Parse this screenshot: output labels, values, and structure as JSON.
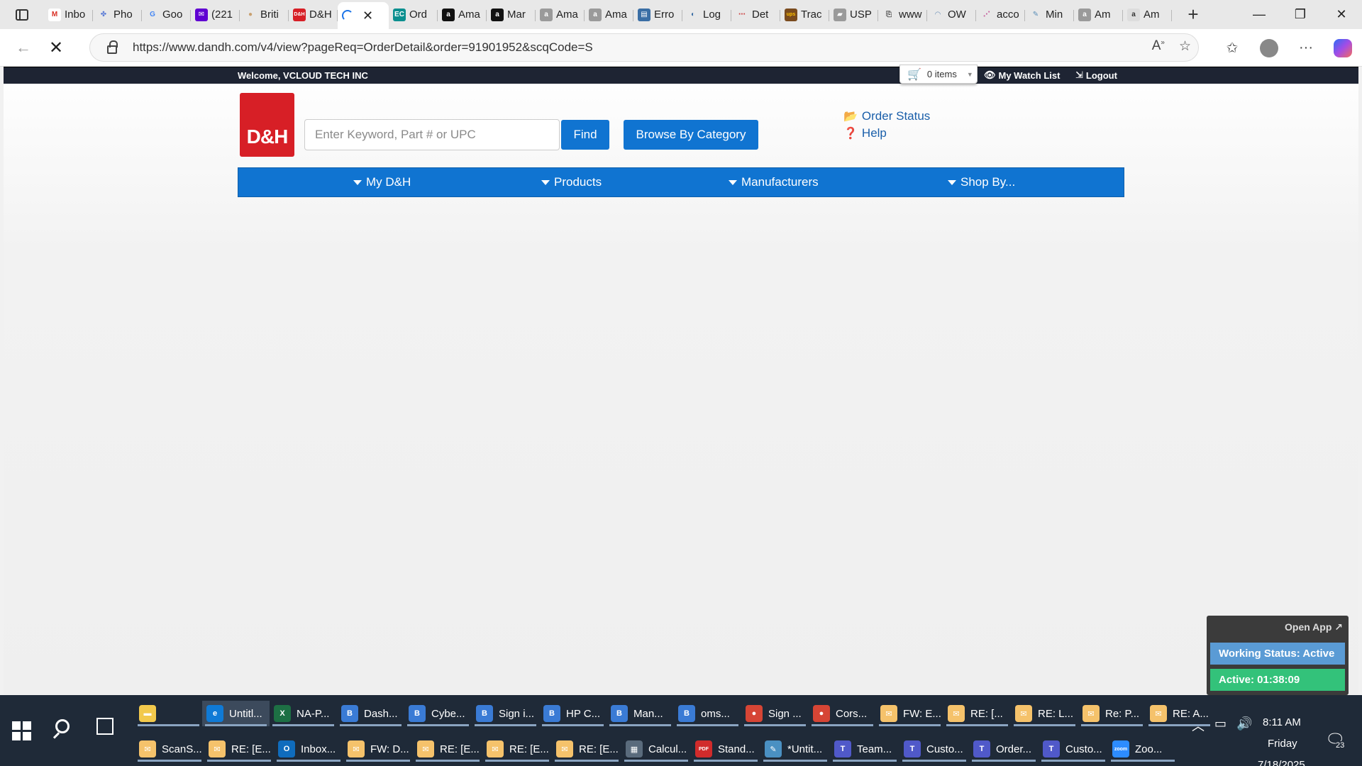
{
  "browser": {
    "tabs": [
      {
        "title": "Inbo",
        "fav_color": "#ffffff",
        "fav_text": "M",
        "fav_fg": "#d93025"
      },
      {
        "title": "Pho",
        "fav_color": "#e8e8e8",
        "fav_text": "✤",
        "fav_fg": "#5a7bd6"
      },
      {
        "title": "Goo",
        "fav_color": "#e8e8e8",
        "fav_text": "G",
        "fav_fg": "#4285f4"
      },
      {
        "title": "(221",
        "fav_color": "#6001d2",
        "fav_text": "✉",
        "fav_fg": "#ffffff"
      },
      {
        "title": "Briti",
        "fav_color": "#e8e8e8",
        "fav_text": "●",
        "fav_fg": "#c8a070"
      },
      {
        "title": "D&H",
        "fav_color": "#d71f26",
        "fav_text": "D&H",
        "fav_fg": "#ffffff"
      },
      {
        "title": "",
        "loading": true
      },
      {
        "title": "Ord",
        "fav_color": "#0b8f8f",
        "fav_text": "EC",
        "fav_fg": "#ffffff"
      },
      {
        "title": "Ama",
        "fav_color": "#111111",
        "fav_text": "a",
        "fav_fg": "#ffffff"
      },
      {
        "title": "Mar",
        "fav_color": "#111111",
        "fav_text": "a",
        "fav_fg": "#ffffff"
      },
      {
        "title": "Ama",
        "fav_color": "#9a9a9a",
        "fav_text": "a",
        "fav_fg": "#ffffff"
      },
      {
        "title": "Ama",
        "fav_color": "#9a9a9a",
        "fav_text": "a",
        "fav_fg": "#ffffff"
      },
      {
        "title": "Erro",
        "fav_color": "#3a6ea5",
        "fav_text": "▤",
        "fav_fg": "#ffffff"
      },
      {
        "title": "Log",
        "fav_color": "#e8e8e8",
        "fav_text": "◐",
        "fav_fg": "#3a6ea5"
      },
      {
        "title": "Det",
        "fav_color": "#e8e8e8",
        "fav_text": "⋯",
        "fav_fg": "#c44"
      },
      {
        "title": "Trac",
        "fav_color": "#7a4b1e",
        "fav_text": "ups",
        "fav_fg": "#ffc300"
      },
      {
        "title": "USP",
        "fav_color": "#9a9a9a",
        "fav_text": "▰",
        "fav_fg": "#ffffff"
      },
      {
        "title": "www",
        "fav_color": "#e8e8e8",
        "fav_text": "⎘",
        "fav_fg": "#555"
      },
      {
        "title": "OW",
        "fav_color": "#e8e8e8",
        "fav_text": "◠",
        "fav_fg": "#6b8fb8"
      },
      {
        "title": "acco",
        "fav_color": "#e8e8e8",
        "fav_text": "⋰",
        "fav_fg": "#c45a9a"
      },
      {
        "title": "Min",
        "fav_color": "#e8e8e8",
        "fav_text": "✎",
        "fav_fg": "#5a8fb8"
      },
      {
        "title": "Am",
        "fav_color": "#9a9a9a",
        "fav_text": "a",
        "fav_fg": "#ffffff"
      },
      {
        "title": "Am",
        "fav_color": "#dddddd",
        "fav_text": "a",
        "fav_fg": "#333"
      }
    ],
    "url": "https://www.dandh.com/v4/view?pageReq=OrderDetail&order=91901952&scqCode=S",
    "new_tab_glyph": "+",
    "close_glyph": "✕"
  },
  "header": {
    "welcome": "Welcome, VCLOUD TECH INC",
    "cart_label": "0 items",
    "watch_list": "My Watch List",
    "logout": "Logout",
    "logo_text": "D&H",
    "search_placeholder": "Enter Keyword, Part # or UPC",
    "find_label": "Find",
    "browse_label": "Browse By Category",
    "order_status": "Order Status",
    "help": "Help"
  },
  "nav": {
    "items": [
      "My D&H",
      "Products",
      "Manufacturers",
      "Shop By..."
    ]
  },
  "tracker": {
    "open_app": "Open App ↗",
    "working_status": "Working Status: Active",
    "active_time": "Active: 01:38:09"
  },
  "taskbar": {
    "row1": [
      {
        "label": "",
        "icon_color": "#f2c94c",
        "icon_text": "▬"
      },
      {
        "label": "Untitl...",
        "icon_color": "#0f7ad6",
        "icon_text": "e",
        "active": true
      },
      {
        "label": "NA-P...",
        "icon_color": "#1d7044",
        "icon_text": "X"
      },
      {
        "label": "Dash...",
        "icon_color": "#3a7bd5",
        "icon_text": "B"
      },
      {
        "label": "Cybe...",
        "icon_color": "#3a7bd5",
        "icon_text": "B"
      },
      {
        "label": "Sign i...",
        "icon_color": "#3a7bd5",
        "icon_text": "B"
      },
      {
        "label": "HP C...",
        "icon_color": "#3a7bd5",
        "icon_text": "B"
      },
      {
        "label": "Man...",
        "icon_color": "#3a7bd5",
        "icon_text": "B"
      },
      {
        "label": "oms...",
        "icon_color": "#3a7bd5",
        "icon_text": "B"
      },
      {
        "label": "Sign ...",
        "icon_color": "#d64535",
        "icon_text": "●"
      },
      {
        "label": "Cors...",
        "icon_color": "#d64535",
        "icon_text": "●"
      },
      {
        "label": "FW: E...",
        "icon_color": "#f5c26b",
        "icon_text": "✉"
      },
      {
        "label": "RE: [...",
        "icon_color": "#f5c26b",
        "icon_text": "✉"
      },
      {
        "label": "RE: L...",
        "icon_color": "#f5c26b",
        "icon_text": "✉"
      },
      {
        "label": "Re: P...",
        "icon_color": "#f5c26b",
        "icon_text": "✉"
      },
      {
        "label": "RE: A...",
        "icon_color": "#f5c26b",
        "icon_text": "✉"
      }
    ],
    "row2": [
      {
        "label": "ScanS...",
        "icon_color": "#f5c26b",
        "icon_text": "✉"
      },
      {
        "label": "RE: [E...",
        "icon_color": "#f5c26b",
        "icon_text": "✉"
      },
      {
        "label": "Inbox...",
        "icon_color": "#0f6cbd",
        "icon_text": "O"
      },
      {
        "label": "FW: D...",
        "icon_color": "#f5c26b",
        "icon_text": "✉"
      },
      {
        "label": "RE: [E...",
        "icon_color": "#f5c26b",
        "icon_text": "✉"
      },
      {
        "label": "RE: [E...",
        "icon_color": "#f5c26b",
        "icon_text": "✉"
      },
      {
        "label": "RE: [E...",
        "icon_color": "#f5c26b",
        "icon_text": "✉"
      },
      {
        "label": "Calcul...",
        "icon_color": "#5a6b7c",
        "icon_text": "▦"
      },
      {
        "label": "Stand...",
        "icon_color": "#d12b2b",
        "icon_text": "PDF"
      },
      {
        "label": "*Untit...",
        "icon_color": "#4a90c2",
        "icon_text": "✎"
      },
      {
        "label": "Team...",
        "icon_color": "#5059c9",
        "icon_text": "T"
      },
      {
        "label": "Custo...",
        "icon_color": "#5059c9",
        "icon_text": "T"
      },
      {
        "label": "Order...",
        "icon_color": "#5059c9",
        "icon_text": "T"
      },
      {
        "label": "Custo...",
        "icon_color": "#5059c9",
        "icon_text": "T"
      },
      {
        "label": "Zoo...",
        "icon_color": "#2d8cff",
        "icon_text": "zoom"
      }
    ],
    "time": "8:11 AM",
    "day": "Friday",
    "date": "7/18/2025",
    "notification_count": "23"
  }
}
